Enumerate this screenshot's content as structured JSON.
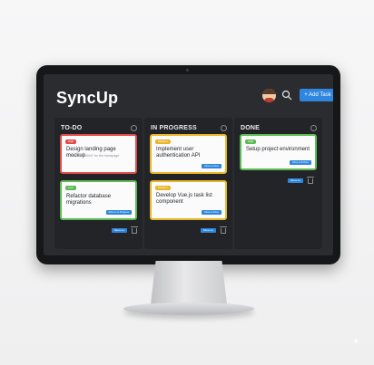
{
  "app": {
    "title": "SyncUp",
    "add_task_label": "+ Add Task"
  },
  "columns": [
    {
      "title": "TO-DO",
      "cards": [
        {
          "tag": "High",
          "title": "Design landing page mockup",
          "subtitle": "Create initial UI/UX for the homepage",
          "button": ""
        },
        {
          "tag": "Low",
          "title": "Refactor database migrations",
          "subtitle": "",
          "button": "Move to In Progress"
        }
      ],
      "footer_move": "Move to"
    },
    {
      "title": "IN PROGRESS",
      "cards": [
        {
          "tag": "Medium",
          "title": "Implement user authentication API",
          "subtitle": "",
          "button": "Move to Done"
        },
        {
          "tag": "Medium",
          "title": "Develop Vue.js task list component",
          "subtitle": "",
          "button": "Move to Done"
        }
      ],
      "footer_move": "Move to"
    },
    {
      "title": "DONE",
      "cards": [
        {
          "tag": "High",
          "title": "Setup project environment",
          "subtitle": "",
          "button": "Move to Archive"
        }
      ],
      "footer_move": "Move to"
    }
  ],
  "colors": {
    "accent": "#2f86de",
    "high": "#e24b47",
    "medium": "#e8b629",
    "low": "#5dbb54"
  },
  "icons": {
    "search": "search-icon",
    "options": "options-icon",
    "trash": "trash-icon"
  }
}
